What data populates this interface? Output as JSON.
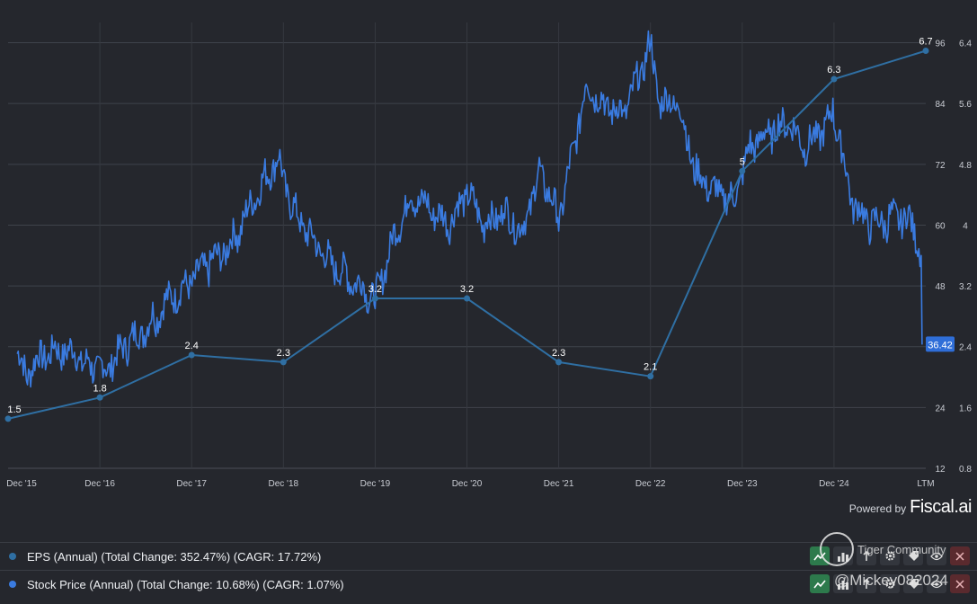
{
  "chart_data": {
    "type": "line",
    "x_categories": [
      "Dec '15",
      "Dec '16",
      "Dec '17",
      "Dec '18",
      "Dec '19",
      "Dec '20",
      "Dec '21",
      "Dec '22",
      "Dec '23",
      "Dec '24",
      "LTM"
    ],
    "left_axis_ticks": [],
    "right_axis_price_ticks": [
      "96",
      "84",
      "72",
      "60",
      "48",
      "36",
      "24",
      "12"
    ],
    "right_axis_eps_ticks": [
      "6.4",
      "5.6",
      "4.8",
      "4",
      "3.2",
      "2.4",
      "1.6",
      "0.8"
    ],
    "price_ylim": [
      12,
      100
    ],
    "eps_ylim": [
      0.8,
      7.1
    ],
    "grid": true,
    "series": [
      {
        "name": "EPS (Annual)",
        "axis": "right-eps",
        "color": "#2f6fa3",
        "x_index": [
          0,
          1,
          2,
          3,
          4,
          5,
          6,
          7,
          8,
          9,
          10
        ],
        "values": [
          1.5,
          1.8,
          2.4,
          2.3,
          3.2,
          3.2,
          2.3,
          2.1,
          5,
          6.3,
          6.7
        ],
        "labels": [
          "1.5",
          "1.8",
          "2.4",
          "2.3",
          "3.2",
          "3.2",
          "2.3",
          "2.1",
          "5",
          "6.3",
          "6.7"
        ]
      },
      {
        "name": "Stock Price (Annual)",
        "axis": "right-price",
        "color": "#3a7be0",
        "anchors_x_index": [
          0.1,
          0.2,
          0.5,
          0.9,
          1.0,
          1.3,
          1.6,
          1.9,
          2.2,
          2.5,
          2.8,
          2.95,
          3.1,
          3.3,
          3.5,
          3.7,
          3.9,
          4.0,
          4.2,
          4.4,
          4.6,
          4.8,
          5.0,
          5.2,
          5.4,
          5.6,
          5.8,
          6.0,
          6.15,
          6.3,
          6.5,
          6.7,
          6.9,
          7.0,
          7.1,
          7.3,
          7.5,
          7.7,
          7.9,
          8.1,
          8.3,
          8.5,
          8.7,
          9.0,
          9.2,
          9.4,
          9.6,
          9.8,
          9.9,
          9.95
        ],
        "anchors_price": [
          34,
          31,
          36,
          33,
          31,
          36,
          42,
          48,
          52,
          58,
          70,
          73,
          63,
          58,
          53,
          50,
          47,
          45,
          58,
          66,
          63,
          60,
          66,
          60,
          63,
          59,
          71,
          61,
          74,
          88,
          84,
          82,
          90,
          96,
          84,
          84,
          70,
          67,
          65,
          76,
          78,
          80,
          75,
          82,
          64,
          60,
          61,
          62,
          58,
          54
        ],
        "last_value": 36.42,
        "last_label": "36.42"
      }
    ]
  },
  "branding": {
    "powered_by": "Powered by",
    "brand": "Fiscal.ai"
  },
  "legend": [
    {
      "text": "EPS (Annual) (Total Change: 352.47%) (CAGR: 17.72%)",
      "color": "#2f6fa3"
    },
    {
      "text": "Stock Price (Annual) (Total Change: 10.68%) (CAGR: 1.07%)",
      "color": "#3a7be0"
    }
  ],
  "watermark": {
    "community": "Tiger Community",
    "user": "@Mickey082024"
  },
  "icons": [
    "line-chart-icon",
    "bar-chart-icon",
    "gear-icon",
    "tag-icon",
    "eye-icon",
    "close-icon"
  ]
}
